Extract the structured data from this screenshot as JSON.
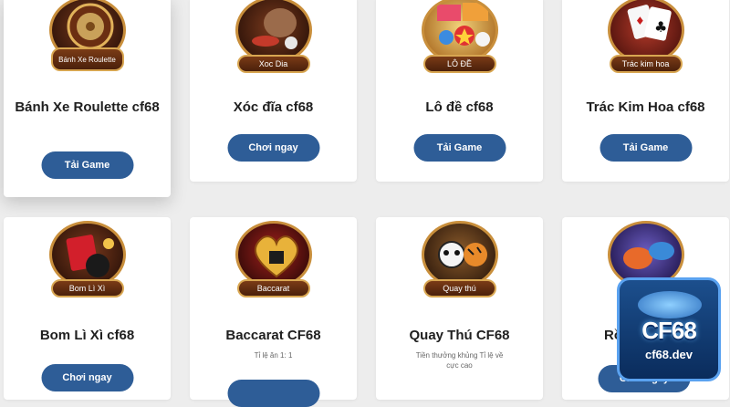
{
  "games": [
    {
      "title": "Bánh Xe Roulette cf68",
      "plaque": "Bánh Xe Roulette",
      "button": "Tải Game",
      "description": "",
      "icon": "roulette-wheel"
    },
    {
      "title": "Xóc đĩa cf68",
      "plaque": "Xoc Dia",
      "button": "Chơi ngay",
      "description": "",
      "icon": "dice-bowl"
    },
    {
      "title": "Lô đề cf68",
      "plaque": "LÔ ĐỀ",
      "button": "Tải Game",
      "description": "",
      "icon": "bingo-balls"
    },
    {
      "title": "Trác Kim Hoa cf68",
      "plaque": "Trác kim hoa",
      "button": "Tải Game",
      "description": "",
      "icon": "playing-cards"
    },
    {
      "title": "Bom Lì Xì cf68",
      "plaque": "Bom Lì Xì",
      "button": "Chơi ngay",
      "description": "",
      "icon": "red-envelope-bomb"
    },
    {
      "title": "Baccarat CF68",
      "plaque": "Baccarat",
      "button": "",
      "description": "Tỉ lệ ăn 1: 1",
      "icon": "heart-crown"
    },
    {
      "title": "Quay Thú CF68",
      "plaque": "Quay thú",
      "button": "",
      "description": "Tiền thưởng khủng Tỉ lệ về cực cao",
      "icon": "panda-tiger"
    },
    {
      "title": "Rồ",
      "plaque": "",
      "button": "Chơi ngay",
      "description": "",
      "icon": "dragon-fish"
    }
  ],
  "logo": {
    "main": "CF68",
    "sub": "cf68.dev"
  },
  "colors": {
    "button": "#2e5d97",
    "background": "#ededed",
    "card": "#ffffff"
  }
}
